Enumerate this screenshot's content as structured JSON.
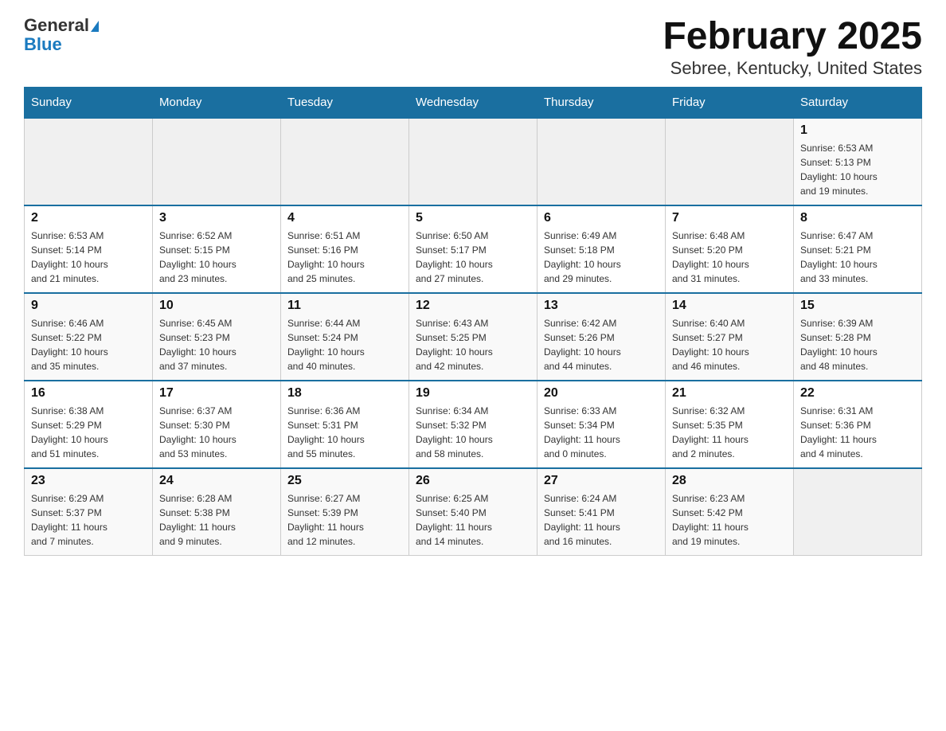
{
  "header": {
    "logo_general": "General",
    "logo_blue": "Blue",
    "title": "February 2025",
    "subtitle": "Sebree, Kentucky, United States"
  },
  "days_of_week": [
    "Sunday",
    "Monday",
    "Tuesday",
    "Wednesday",
    "Thursday",
    "Friday",
    "Saturday"
  ],
  "weeks": [
    [
      {
        "day": "",
        "info": ""
      },
      {
        "day": "",
        "info": ""
      },
      {
        "day": "",
        "info": ""
      },
      {
        "day": "",
        "info": ""
      },
      {
        "day": "",
        "info": ""
      },
      {
        "day": "",
        "info": ""
      },
      {
        "day": "1",
        "info": "Sunrise: 6:53 AM\nSunset: 5:13 PM\nDaylight: 10 hours\nand 19 minutes."
      }
    ],
    [
      {
        "day": "2",
        "info": "Sunrise: 6:53 AM\nSunset: 5:14 PM\nDaylight: 10 hours\nand 21 minutes."
      },
      {
        "day": "3",
        "info": "Sunrise: 6:52 AM\nSunset: 5:15 PM\nDaylight: 10 hours\nand 23 minutes."
      },
      {
        "day": "4",
        "info": "Sunrise: 6:51 AM\nSunset: 5:16 PM\nDaylight: 10 hours\nand 25 minutes."
      },
      {
        "day": "5",
        "info": "Sunrise: 6:50 AM\nSunset: 5:17 PM\nDaylight: 10 hours\nand 27 minutes."
      },
      {
        "day": "6",
        "info": "Sunrise: 6:49 AM\nSunset: 5:18 PM\nDaylight: 10 hours\nand 29 minutes."
      },
      {
        "day": "7",
        "info": "Sunrise: 6:48 AM\nSunset: 5:20 PM\nDaylight: 10 hours\nand 31 minutes."
      },
      {
        "day": "8",
        "info": "Sunrise: 6:47 AM\nSunset: 5:21 PM\nDaylight: 10 hours\nand 33 minutes."
      }
    ],
    [
      {
        "day": "9",
        "info": "Sunrise: 6:46 AM\nSunset: 5:22 PM\nDaylight: 10 hours\nand 35 minutes."
      },
      {
        "day": "10",
        "info": "Sunrise: 6:45 AM\nSunset: 5:23 PM\nDaylight: 10 hours\nand 37 minutes."
      },
      {
        "day": "11",
        "info": "Sunrise: 6:44 AM\nSunset: 5:24 PM\nDaylight: 10 hours\nand 40 minutes."
      },
      {
        "day": "12",
        "info": "Sunrise: 6:43 AM\nSunset: 5:25 PM\nDaylight: 10 hours\nand 42 minutes."
      },
      {
        "day": "13",
        "info": "Sunrise: 6:42 AM\nSunset: 5:26 PM\nDaylight: 10 hours\nand 44 minutes."
      },
      {
        "day": "14",
        "info": "Sunrise: 6:40 AM\nSunset: 5:27 PM\nDaylight: 10 hours\nand 46 minutes."
      },
      {
        "day": "15",
        "info": "Sunrise: 6:39 AM\nSunset: 5:28 PM\nDaylight: 10 hours\nand 48 minutes."
      }
    ],
    [
      {
        "day": "16",
        "info": "Sunrise: 6:38 AM\nSunset: 5:29 PM\nDaylight: 10 hours\nand 51 minutes."
      },
      {
        "day": "17",
        "info": "Sunrise: 6:37 AM\nSunset: 5:30 PM\nDaylight: 10 hours\nand 53 minutes."
      },
      {
        "day": "18",
        "info": "Sunrise: 6:36 AM\nSunset: 5:31 PM\nDaylight: 10 hours\nand 55 minutes."
      },
      {
        "day": "19",
        "info": "Sunrise: 6:34 AM\nSunset: 5:32 PM\nDaylight: 10 hours\nand 58 minutes."
      },
      {
        "day": "20",
        "info": "Sunrise: 6:33 AM\nSunset: 5:34 PM\nDaylight: 11 hours\nand 0 minutes."
      },
      {
        "day": "21",
        "info": "Sunrise: 6:32 AM\nSunset: 5:35 PM\nDaylight: 11 hours\nand 2 minutes."
      },
      {
        "day": "22",
        "info": "Sunrise: 6:31 AM\nSunset: 5:36 PM\nDaylight: 11 hours\nand 4 minutes."
      }
    ],
    [
      {
        "day": "23",
        "info": "Sunrise: 6:29 AM\nSunset: 5:37 PM\nDaylight: 11 hours\nand 7 minutes."
      },
      {
        "day": "24",
        "info": "Sunrise: 6:28 AM\nSunset: 5:38 PM\nDaylight: 11 hours\nand 9 minutes."
      },
      {
        "day": "25",
        "info": "Sunrise: 6:27 AM\nSunset: 5:39 PM\nDaylight: 11 hours\nand 12 minutes."
      },
      {
        "day": "26",
        "info": "Sunrise: 6:25 AM\nSunset: 5:40 PM\nDaylight: 11 hours\nand 14 minutes."
      },
      {
        "day": "27",
        "info": "Sunrise: 6:24 AM\nSunset: 5:41 PM\nDaylight: 11 hours\nand 16 minutes."
      },
      {
        "day": "28",
        "info": "Sunrise: 6:23 AM\nSunset: 5:42 PM\nDaylight: 11 hours\nand 19 minutes."
      },
      {
        "day": "",
        "info": ""
      }
    ]
  ]
}
